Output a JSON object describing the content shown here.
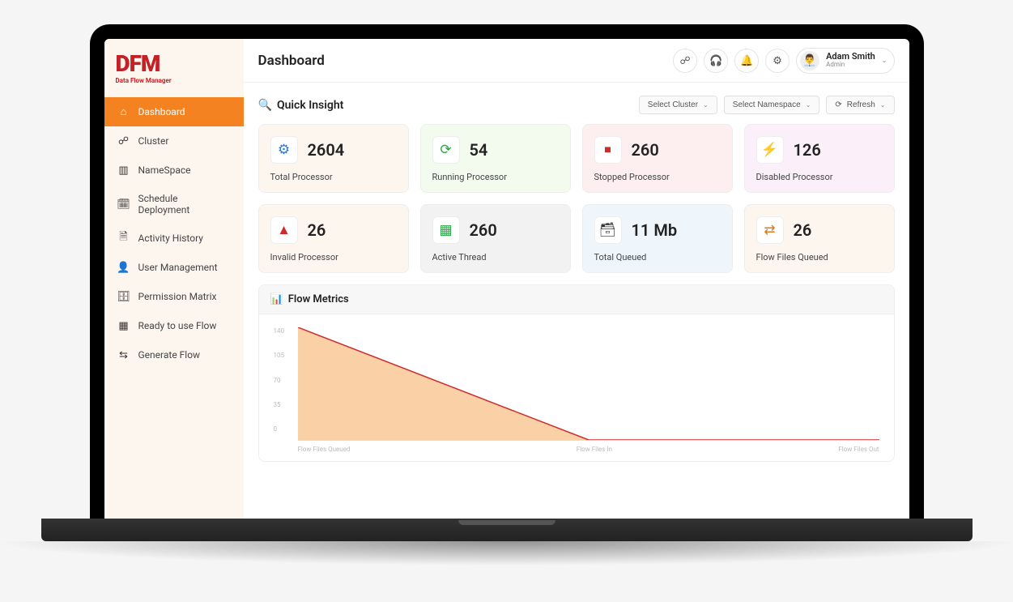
{
  "brand": {
    "name": "DFM",
    "subtitle": "Data Flow Manager"
  },
  "header": {
    "title": "Dashboard",
    "user": {
      "name": "Adam Smith",
      "role": "Admin"
    }
  },
  "sidebar": {
    "items": [
      {
        "label": "Dashboard",
        "icon": "home-icon"
      },
      {
        "label": "Cluster",
        "icon": "cluster-icon"
      },
      {
        "label": "NameSpace",
        "icon": "namespace-icon"
      },
      {
        "label": "Schedule Deployment",
        "icon": "calendar-icon"
      },
      {
        "label": "Activity History",
        "icon": "history-icon"
      },
      {
        "label": "User Management",
        "icon": "users-icon"
      },
      {
        "label": "Permission Matrix",
        "icon": "permission-icon"
      },
      {
        "label": "Ready to use Flow",
        "icon": "flow-icon"
      },
      {
        "label": "Generate Flow",
        "icon": "generate-icon"
      }
    ],
    "active_index": 0
  },
  "insight": {
    "title": "Quick Insight",
    "filters": {
      "cluster": "Select Cluster",
      "namespace": "Select Namespace",
      "refresh": "Refresh"
    },
    "cards": [
      {
        "value": "2604",
        "label": "Total Processor",
        "bg": "#fdf6ef",
        "iconColor": "#2e7bd6"
      },
      {
        "value": "54",
        "label": "Running Processor",
        "bg": "#f3fbee",
        "iconColor": "#28a745"
      },
      {
        "value": "260",
        "label": "Stopped Processor",
        "bg": "#fdeef0",
        "iconColor": "#d02b2b"
      },
      {
        "value": "126",
        "label": "Disabled Processor",
        "bg": "#fbf0fa",
        "iconColor": "#888"
      },
      {
        "value": "26",
        "label": "Invalid Processor",
        "bg": "#fdf6ef",
        "iconColor": "#d02b2b"
      },
      {
        "value": "260",
        "label": "Active Thread",
        "bg": "#f2f2f2",
        "iconColor": "#28a745"
      },
      {
        "value": "11 Mb",
        "label": "Total Queued",
        "bg": "#eef6fb",
        "iconColor": "#333"
      },
      {
        "value": "26",
        "label": "Flow Files Queued",
        "bg": "#fdf6ef",
        "iconColor": "#d97a1b"
      }
    ]
  },
  "metrics": {
    "title": "Flow Metrics"
  },
  "chart_data": {
    "type": "area",
    "categories": [
      "Flow Files Queued",
      "Flow Files In",
      "Flow Files Out"
    ],
    "values": [
      160,
      0,
      0
    ],
    "title": "Flow Metrics",
    "xlabel": "",
    "ylabel": "",
    "ylim": [
      0,
      160
    ],
    "y_ticks": [
      140,
      105,
      70,
      35,
      0
    ],
    "line_color": "#d02b2b",
    "fill_color": "#f7b26b"
  }
}
